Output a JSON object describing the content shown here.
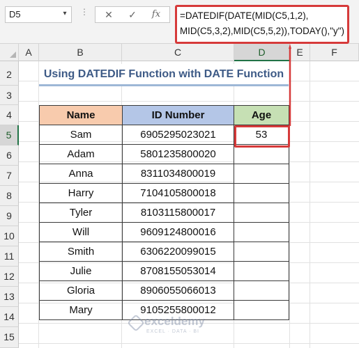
{
  "formula_bar": {
    "name_box": "D5",
    "cancel_icon": "✕",
    "enter_icon": "✓",
    "fx_label": "fx",
    "formula": "=DATEDIF(DATE(MID(C5,1,2),\nMID(C5,3,2),MID(C5,5,2)),TODAY(),\"y\")"
  },
  "columns": [
    "A",
    "B",
    "C",
    "D",
    "E",
    "F"
  ],
  "selected_column": "D",
  "rows": [
    "2",
    "3",
    "4",
    "5",
    "6",
    "7",
    "8",
    "9",
    "10",
    "11",
    "12",
    "13",
    "14",
    "15"
  ],
  "selected_row": "5",
  "title": "Using DATEDIF Function with DATE Function",
  "table": {
    "headers": {
      "name": "Name",
      "id": "ID Number",
      "age": "Age"
    },
    "rows": [
      {
        "name": "Sam",
        "id": "6905295023021",
        "age": "53"
      },
      {
        "name": "Adam",
        "id": "5801235800020",
        "age": ""
      },
      {
        "name": "Anna",
        "id": "8311034800019",
        "age": ""
      },
      {
        "name": "Harry",
        "id": "7104105800018",
        "age": ""
      },
      {
        "name": "Tyler",
        "id": "8103115800017",
        "age": ""
      },
      {
        "name": "Will",
        "id": "9609124800016",
        "age": ""
      },
      {
        "name": "Smith",
        "id": "6306220099015",
        "age": ""
      },
      {
        "name": "Julie",
        "id": "8708155053014",
        "age": ""
      },
      {
        "name": "Gloria",
        "id": "8906055066013",
        "age": ""
      },
      {
        "name": "Mary",
        "id": "9105255800012",
        "age": ""
      }
    ]
  },
  "watermark": {
    "brand": "exceldemy",
    "tagline": "EXCEL · DATA · BI"
  },
  "colors": {
    "highlight": "#d63a3a",
    "excel_green": "#217346",
    "title": "#3d5a86"
  }
}
